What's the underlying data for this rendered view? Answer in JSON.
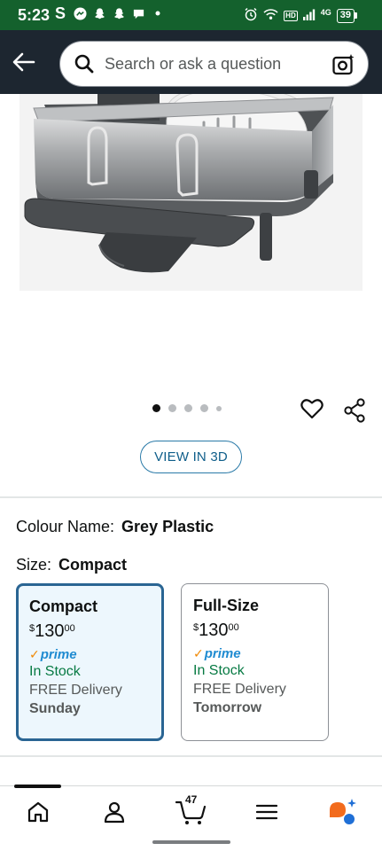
{
  "status_bar": {
    "time": "5:23",
    "left_icons": [
      "s-app-icon",
      "messenger-icon",
      "snapchat-icon",
      "snapchat-icon",
      "chat-bubble-icon",
      "dot-icon"
    ],
    "right_icons": [
      "alarm-icon",
      "wifi-icon",
      "hd-icon",
      "signal-icon",
      "lte-icon"
    ],
    "hd_label": "HD",
    "network_label": "4G",
    "battery_level": "39"
  },
  "search": {
    "placeholder": "Search or ask a question"
  },
  "carousel": {
    "dot_count": 5,
    "active_index": 0
  },
  "view_3d_label": "VIEW IN 3D",
  "colour": {
    "label": "Colour Name:",
    "value": "Grey Plastic"
  },
  "size": {
    "label": "Size:",
    "value": "Compact"
  },
  "options": [
    {
      "name": "Compact",
      "currency": "$",
      "price_whole": "130",
      "price_cents": "00",
      "prime": "prime",
      "stock": "In Stock",
      "delivery": "FREE Delivery",
      "day": "Sunday",
      "selected": true
    },
    {
      "name": "Full-Size",
      "currency": "$",
      "price_whole": "130",
      "price_cents": "00",
      "prime": "prime",
      "stock": "In Stock",
      "delivery": "FREE Delivery",
      "day": "Tomorrow",
      "selected": false
    }
  ],
  "bottom_nav": {
    "items": [
      "home-icon",
      "account-icon",
      "cart-icon",
      "menu-icon",
      "rufus-icon"
    ],
    "cart_count": "47"
  },
  "colors": {
    "status_bar": "#14612d",
    "header": "#1d2630",
    "selected_border": "#2a6593",
    "in_stock": "#077a43",
    "prime_blue": "#1f8bd1",
    "prime_check": "#f08804",
    "link_blue": "#0f5e8a"
  }
}
